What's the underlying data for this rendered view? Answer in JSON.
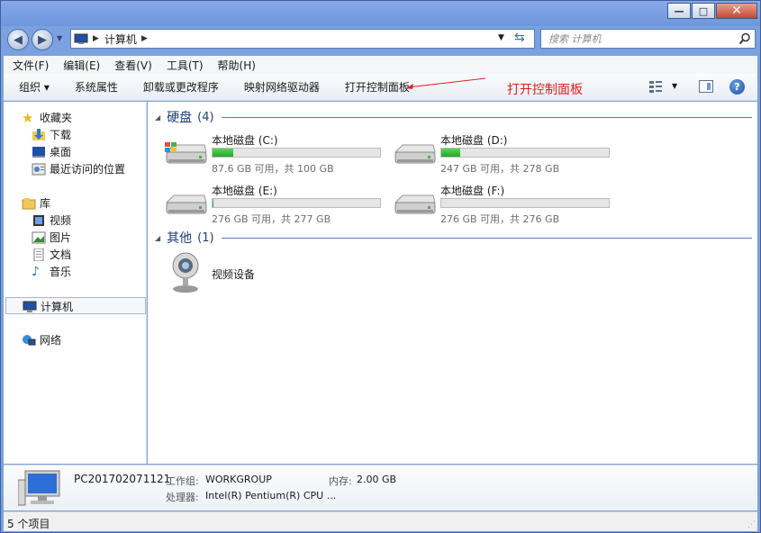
{
  "window": {
    "min_label": "—",
    "max_label": "□",
    "close_label": "✕"
  },
  "address": {
    "crumb": "计算机"
  },
  "search": {
    "placeholder": "搜索 计算机"
  },
  "menu": [
    "文件(F)",
    "编辑(E)",
    "查看(V)",
    "工具(T)",
    "帮助(H)"
  ],
  "toolbar": {
    "organize": "组织 ▾",
    "system_properties": "系统属性",
    "uninstall": "卸载或更改程序",
    "map_drive": "映射网络驱动器",
    "open_control_panel": "打开控制面板"
  },
  "annotation": {
    "text": "打开控制面板",
    "color": "#e02020"
  },
  "sidebar": {
    "favorites": "收藏夹",
    "downloads": "下载",
    "desktop": "桌面",
    "recent": "最近访问的位置",
    "libraries": "库",
    "videos": "视频",
    "pictures": "图片",
    "documents": "文档",
    "music": "音乐",
    "computer": "计算机",
    "network": "网络"
  },
  "groups": {
    "hdd_title": "硬盘",
    "hdd_count": "(4)",
    "other_title": "其他",
    "other_count": "(1)"
  },
  "drives": [
    {
      "name": "本地磁盘 (C:)",
      "size": "87.6 GB 可用，共 100 GB",
      "used_fraction": 0.124
    },
    {
      "name": "本地磁盘 (D:)",
      "size": "247 GB 可用，共 278 GB",
      "used_fraction": 0.112
    },
    {
      "name": "本地磁盘 (E:)",
      "size": "276 GB 可用，共 277 GB",
      "used_fraction": 0.004
    },
    {
      "name": "本地磁盘 (F:)",
      "size": "276 GB 可用，共 276 GB",
      "used_fraction": 0.0
    }
  ],
  "other_device": "视频设备",
  "details": {
    "pc_name": "PC201702071121",
    "workgroup_label": "工作组:",
    "workgroup_value": "WORKGROUP",
    "memory_label": "内存:",
    "memory_value": "2.00 GB",
    "cpu_label": "处理器:",
    "cpu_value": "Intel(R) Pentium(R) CPU ..."
  },
  "status": {
    "items": "5 个项目"
  }
}
